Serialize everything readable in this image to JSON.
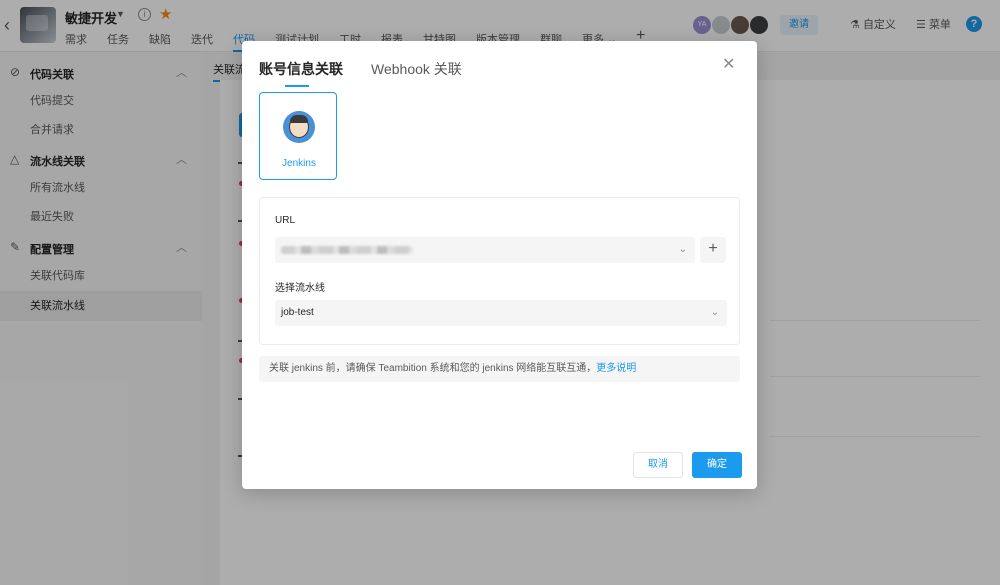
{
  "header": {
    "project_name": "敏捷开发",
    "nav": [
      "需求",
      "任务",
      "缺陷",
      "迭代",
      "代码",
      "测试计划",
      "工时",
      "报表",
      "甘特图",
      "版本管理",
      "群聊",
      "更多"
    ],
    "active_nav_index": 4,
    "avatar_initials": "YA",
    "invite_label": "邀请",
    "customize_label": "自定义",
    "menu_label": "菜单",
    "help_label": "?"
  },
  "sidebar": {
    "groups": [
      {
        "label": "代码关联",
        "items": [
          "代码提交",
          "合并请求"
        ]
      },
      {
        "label": "流水线关联",
        "items": [
          "所有流水线",
          "最近失败"
        ]
      },
      {
        "label": "配置管理",
        "items": [
          "关联代码库",
          "关联流水线"
        ]
      }
    ]
  },
  "main": {
    "tab_label": "关联流"
  },
  "modal": {
    "tabs": [
      "账号信息关联",
      "Webhook 关联"
    ],
    "active_tab_index": 0,
    "provider_label": "Jenkins",
    "url_label": "URL",
    "pipeline_label": "选择流水线",
    "pipeline_value": "job-test",
    "notice_text": "关联 jenkins 前，请确保 Teambition 系统和您的 jenkins 网络能互联互通，",
    "notice_link": "更多说明",
    "cancel_label": "取消",
    "confirm_label": "确定"
  }
}
